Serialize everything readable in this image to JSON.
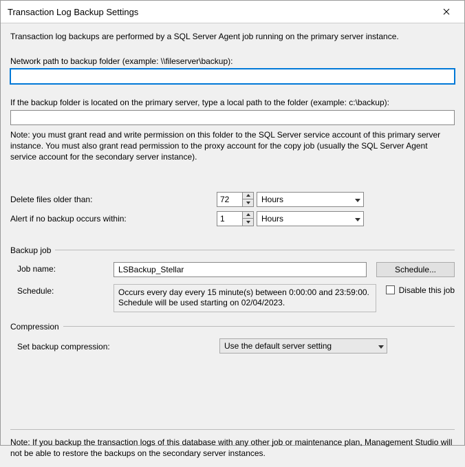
{
  "window": {
    "title": "Transaction Log Backup Settings"
  },
  "intro": "Transaction log backups are performed by a SQL Server Agent job running on the primary server instance.",
  "networkPath": {
    "label": "Network path to backup folder (example: \\\\fileserver\\backup):",
    "value": ""
  },
  "localPath": {
    "label": "If the backup folder is located on the primary server, type a local path to the folder (example: c:\\backup):",
    "value": ""
  },
  "permissionNote": "Note: you must grant read and write permission on this folder to the SQL Server service account of this primary server instance.  You must also grant read permission to the proxy account for the copy job (usually the SQL Server Agent service account for the secondary server instance).",
  "deleteFiles": {
    "label": "Delete files older than:",
    "value": "72",
    "unit": "Hours"
  },
  "alertNoBackup": {
    "label": "Alert if no backup occurs within:",
    "value": "1",
    "unit": "Hours"
  },
  "backupJob": {
    "legend": "Backup job",
    "jobNameLabel": "Job name:",
    "jobNameValue": "LSBackup_Stellar",
    "scheduleButton": "Schedule...",
    "scheduleLabel": "Schedule:",
    "scheduleText": "Occurs every day every 15 minute(s) between 0:00:00 and 23:59:00. Schedule will be used starting on 02/04/2023.",
    "disableLabel": "Disable this job"
  },
  "compression": {
    "legend": "Compression",
    "label": "Set backup compression:",
    "value": "Use the default server setting"
  },
  "bottomNote": "Note: If you backup the transaction logs of this database with any other job or maintenance plan, Management Studio will not be able to restore the backups on the secondary server instances."
}
